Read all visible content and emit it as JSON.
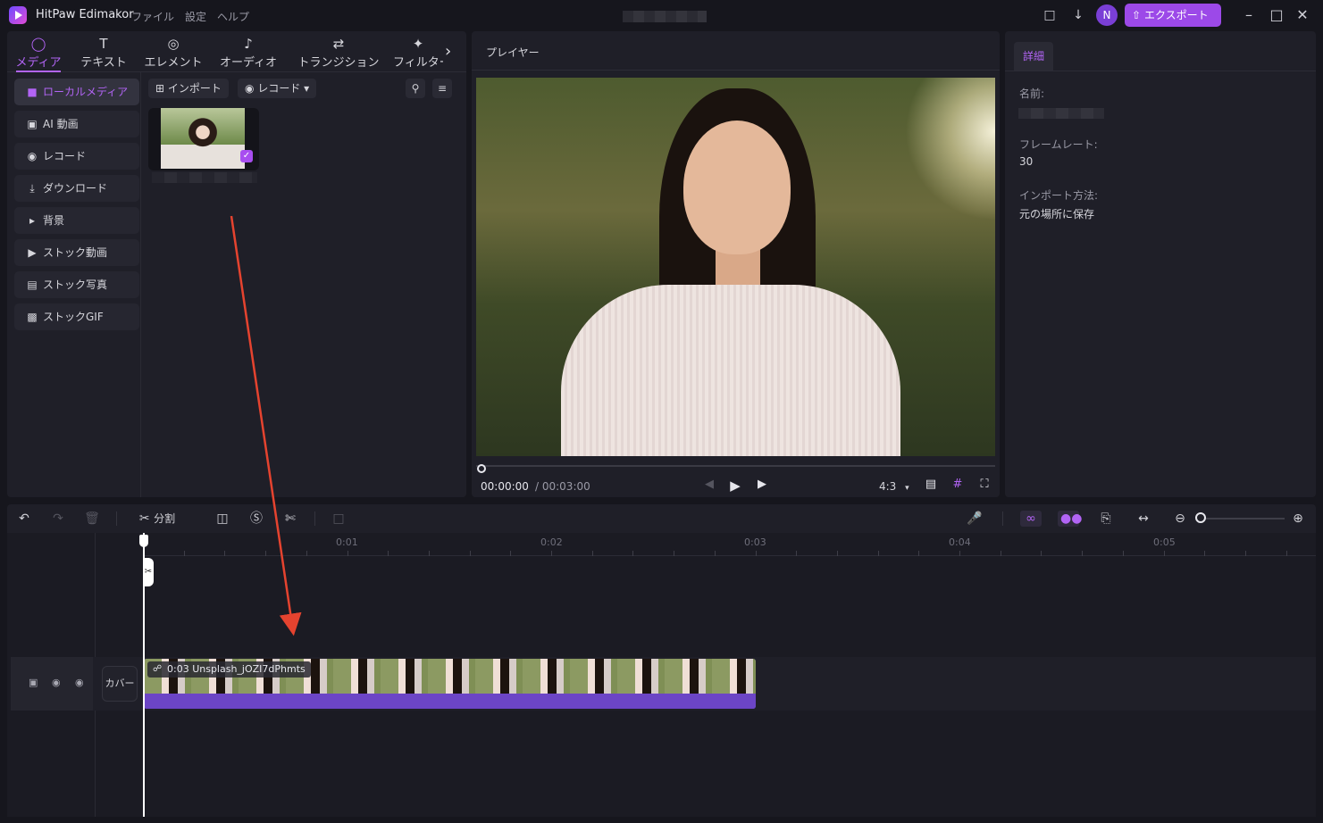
{
  "app": {
    "title": "HitPaw Edimakor",
    "menu": [
      "ファイル",
      "設定",
      "ヘルプ"
    ],
    "export_label": "エクスポート",
    "avatar_initial": "N",
    "accent_color": "#9c49e8"
  },
  "media_tabs": [
    {
      "label": "メディア",
      "icon": "media-icon",
      "active": true
    },
    {
      "label": "テキスト",
      "icon": "text-icon"
    },
    {
      "label": "エレメント",
      "icon": "element-icon"
    },
    {
      "label": "オーディオ",
      "icon": "audio-icon"
    },
    {
      "label": "トランジション",
      "icon": "transition-icon"
    },
    {
      "label": "フィルター",
      "icon": "filter-icon"
    }
  ],
  "sidebar": {
    "items": [
      {
        "label": "ローカルメディア",
        "icon": "folder-icon",
        "active": true
      },
      {
        "label": "AI 動画",
        "icon": "ai-video-icon"
      },
      {
        "label": "レコード",
        "icon": "record-icon"
      },
      {
        "label": "ダウンロード",
        "icon": "download-icon"
      },
      {
        "label": "背景",
        "icon": "triangle-right-icon"
      },
      {
        "label": "ストック動画",
        "icon": "stock-video-icon"
      },
      {
        "label": "ストック写真",
        "icon": "stock-photo-icon"
      },
      {
        "label": "ストックGIF",
        "icon": "gif-icon"
      }
    ]
  },
  "media_toolbar": {
    "import_label": "インポート",
    "record_label": "レコード"
  },
  "player": {
    "title": "プレイヤー",
    "current_time": "00:00:00",
    "total_time": "/ 00:03:00",
    "aspect_ratio": "4:3",
    "progress": 0
  },
  "details": {
    "tab_label": "詳細",
    "name_label": "名前:",
    "framerate_label": "フレームレート:",
    "framerate_value": "30",
    "import_method_label": "インポート方法:",
    "import_method_value": "元の場所に保存"
  },
  "timeline_toolbar": {
    "split_label": "分割"
  },
  "timeline": {
    "ruler_labels": [
      "0:01",
      "0:02",
      "0:03",
      "0:04",
      "0:05"
    ],
    "cover_label": "カバー",
    "clip_label": "0:03  Unsplash_jOZI7dPhmts"
  }
}
